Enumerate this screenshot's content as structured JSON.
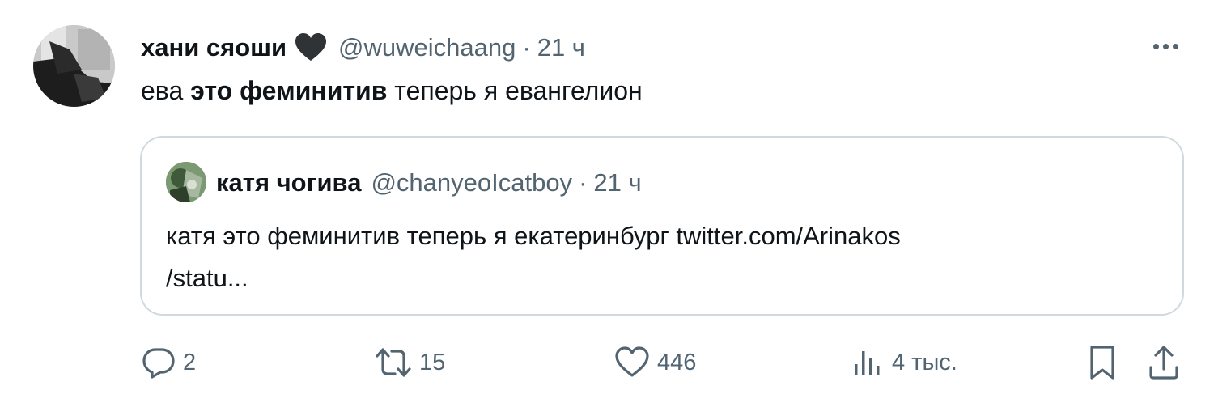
{
  "tweet": {
    "display_name": "хани сяоши",
    "handle": "@wuweichaang",
    "separator": "·",
    "time": "21 ч",
    "text_before": "ева ",
    "text_bold": "это феминитив",
    "text_after": " теперь я евангелион"
  },
  "quote": {
    "display_name": "катя чогива",
    "handle": "@chanyeoIcatboy",
    "separator": "·",
    "time": "21 ч",
    "text_line1": "катя это феминитив теперь я екатеринбург twitter.com/Arinakos",
    "text_line2": "/statu..."
  },
  "actions": {
    "replies": "2",
    "reposts": "15",
    "likes": "446",
    "views": "4 тыс."
  },
  "colors": {
    "text": "#0f1419",
    "secondary": "#536471",
    "border": "#cfd9de"
  },
  "icons": {
    "heart": "black-heart-icon",
    "more": "more-icon",
    "reply": "reply-icon",
    "repost": "repost-icon",
    "like": "like-icon",
    "views": "views-icon",
    "bookmark": "bookmark-icon",
    "share": "share-icon"
  }
}
